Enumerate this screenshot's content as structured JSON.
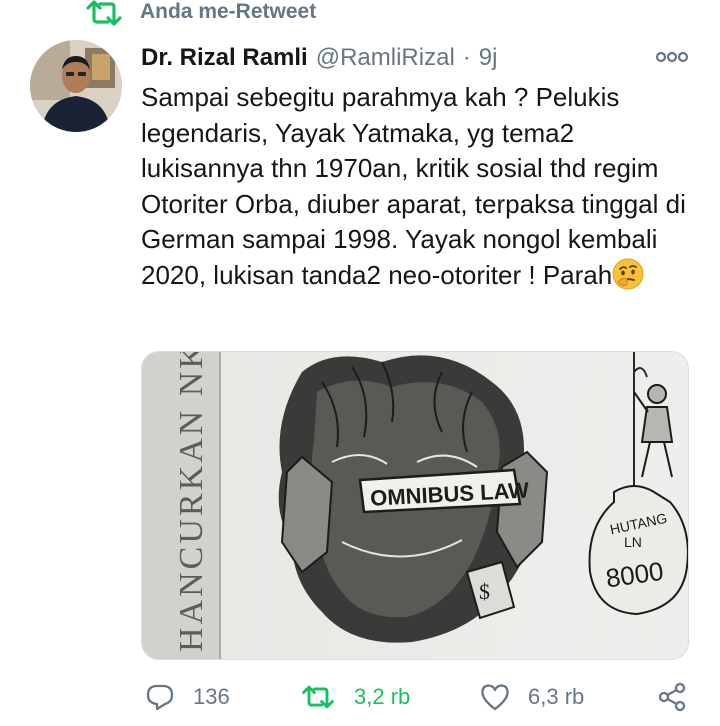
{
  "retweet_context": {
    "label": "Anda me-Retweet"
  },
  "tweet": {
    "author_name": "Dr. Rizal Ramli",
    "handle": "@RamliRizal",
    "separator": "·",
    "time": "9j",
    "text": "Sampai sebegitu parahmya kah ? Pelukis legendaris, Yayak Yatmaka, yg tema2 lukisannya thn 1970an, kritik sosial thd regim Otoriter Orba, diuber aparat, terpaksa tinggal di German sampai 1998. Yayak nongol kembali 2020, lukisan tanda2 neo-otoriter ! Parah"
  },
  "media": {
    "labels": {
      "banner": "OMNIBUS LAW",
      "bag_top": "HUTANG",
      "bag_mid": "LN",
      "bag_amount": "8000",
      "side_text": "HANCURKAN NK"
    }
  },
  "actions": {
    "reply_count": "136",
    "retweet_count": "3,2 rb",
    "like_count": "6,3 rb"
  },
  "colors": {
    "retweet_green": "#17bf63",
    "secondary_text": "#657786",
    "primary_text": "#14171a"
  },
  "icons": [
    "retweet-icon",
    "more-icon",
    "reply-icon",
    "like-icon",
    "share-icon",
    "thinking-face-emoji"
  ]
}
